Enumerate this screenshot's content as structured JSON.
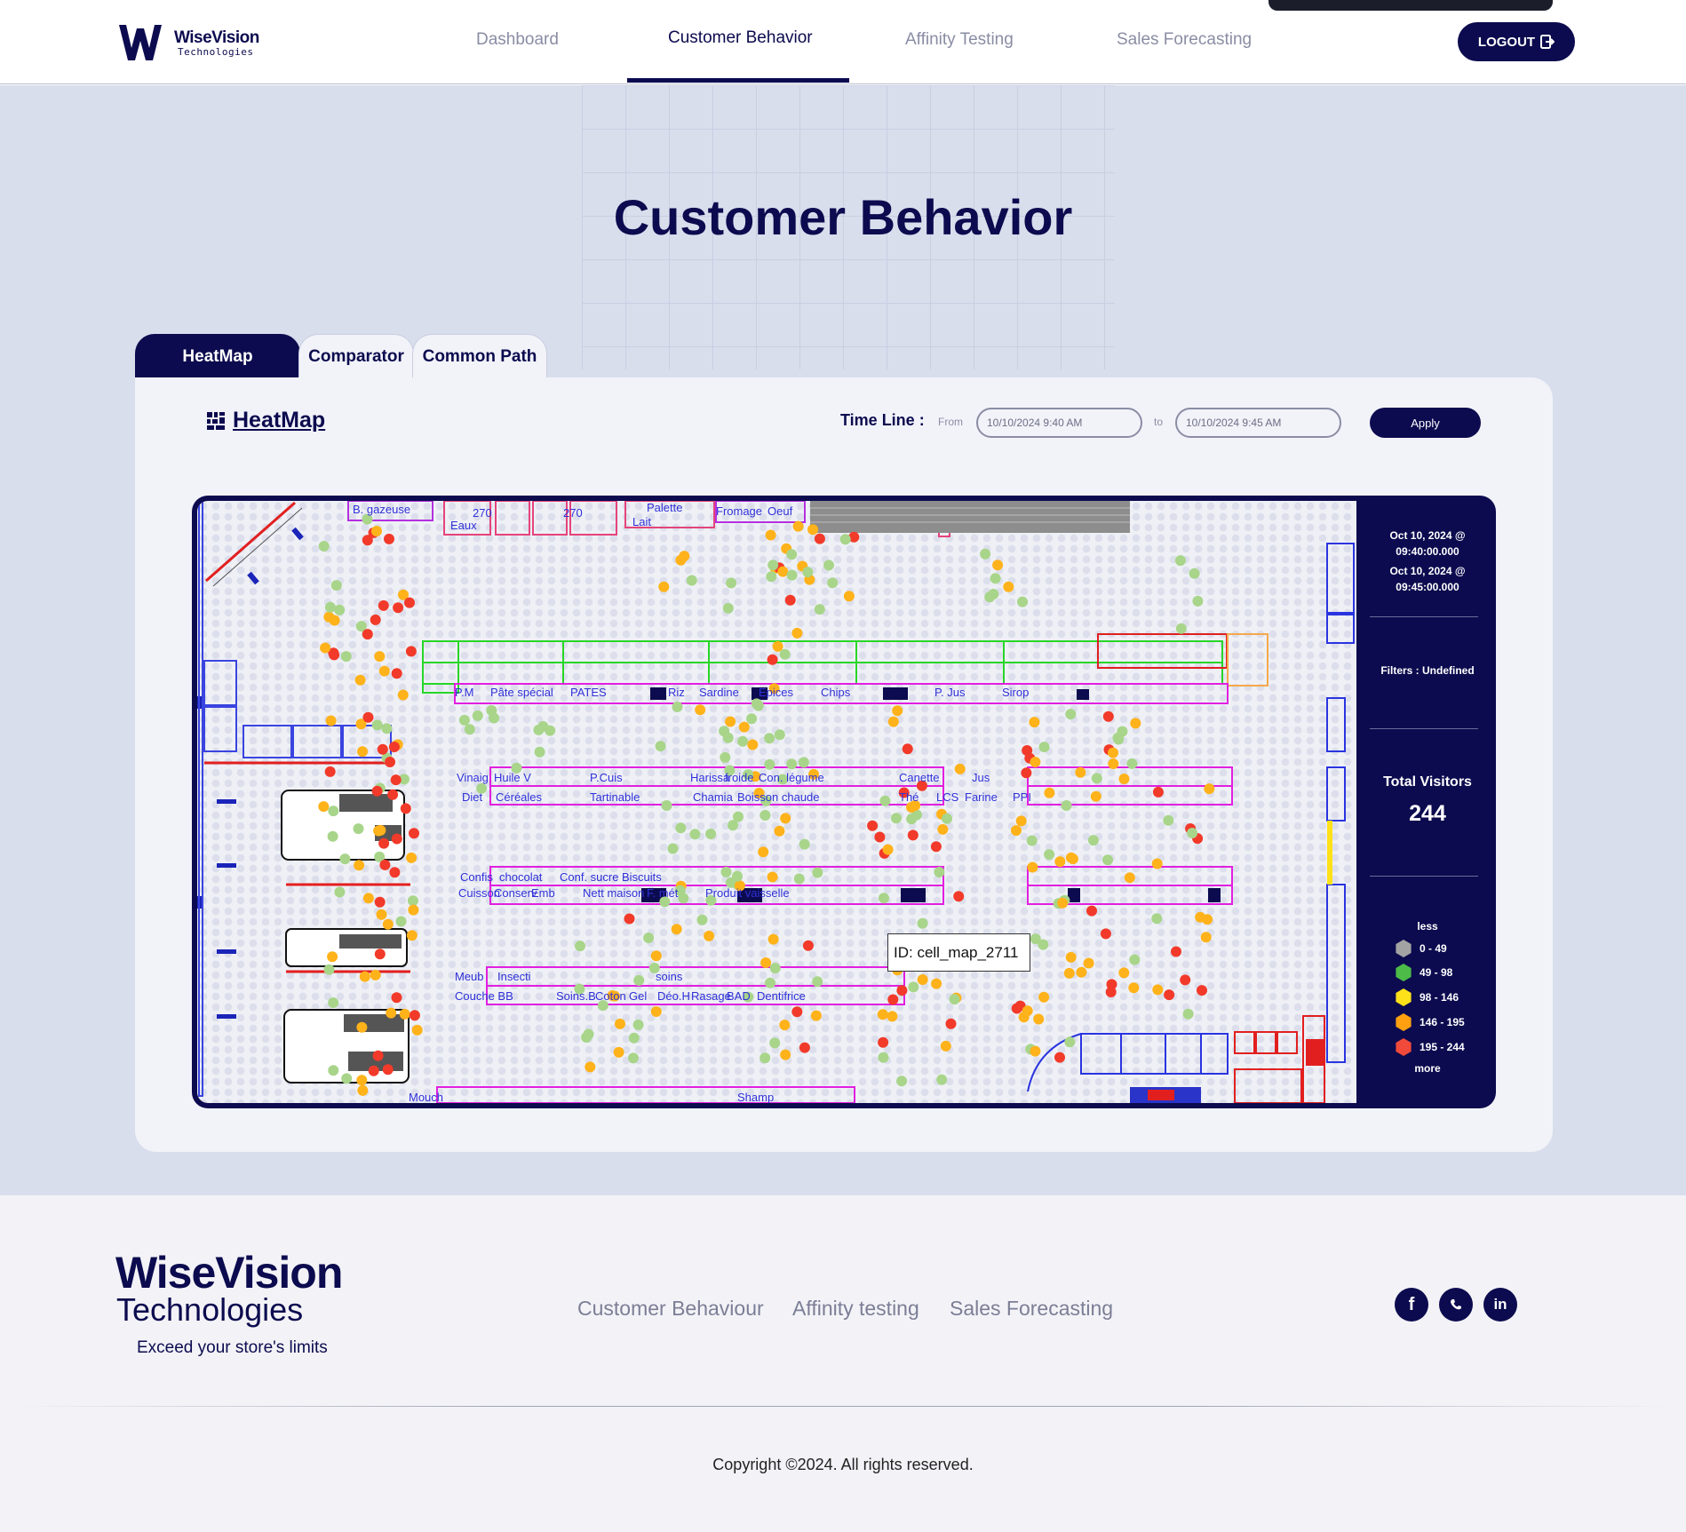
{
  "header": {
    "logo_name": "WiseVision",
    "logo_sub": "Technologies",
    "nav": [
      "Dashboard",
      "Customer Behavior",
      "Affinity Testing",
      "Sales Forecasting"
    ],
    "active_nav": "Customer Behavior",
    "logout_label": "LOGOUT"
  },
  "page": {
    "title": "Customer Behavior",
    "tabs": [
      "HeatMap",
      "Comparator",
      "Common Path"
    ],
    "active_tab": "HeatMap"
  },
  "heatmap": {
    "title": "HeatMap",
    "timeline_label": "Time Line :",
    "from_label": "From",
    "to_label": "to",
    "from_value": "10/10/2024 9:40 AM",
    "to_value": "10/10/2024 9:45 AM",
    "apply_label": "Apply",
    "tooltip": "ID: cell_map_2711",
    "map_labels": [
      "B. gazeuse",
      "Eaux",
      "270",
      "270",
      "Palette",
      "Lait",
      "Fromage",
      "Oeuf",
      "P.M",
      "Pâte spécial",
      "PATES",
      "Riz",
      "Sardine",
      "Epices",
      "Chips",
      "P. Jus",
      "Sirop",
      "Vinaig",
      "Huile V",
      "P.Cuis",
      "Harissa",
      "froide",
      "Con. légume",
      "Diet",
      "Céréales",
      "Tartinable",
      "Chamia",
      "Boisson chaude",
      "Canette",
      "Jus",
      "Thé",
      "LCS",
      "Farine",
      "PPI",
      "Confis",
      "chocolat",
      "Conf. sucre",
      "Biscuits",
      "Cuisson",
      "Conserv",
      "Emb",
      "Nett maison",
      "F. mét",
      "Produit vaisselle",
      "Meub",
      "Insecti",
      "soins",
      "Couche BB",
      "Soins.B",
      "Coton",
      "Gel",
      "Déo.H",
      "Rasage",
      "BAD",
      "Dentifrice",
      "Mouch",
      "Shamp"
    ],
    "side_panel": {
      "from_date": "Oct 10, 2024 @ 09:40:00.000",
      "to_date": "Oct 10, 2024 @ 09:45:00.000",
      "filters": "Filters : Undefined",
      "total_visitors_label": "Total Visitors",
      "total_visitors": "244",
      "legend_top": "less",
      "legend_bottom": "more",
      "legend": [
        {
          "range": "0 - 49",
          "color": "#a3a3a3"
        },
        {
          "range": "49 - 98",
          "color": "#4cbb47"
        },
        {
          "range": "98 - 146",
          "color": "#ffe11a"
        },
        {
          "range": "146 - 195",
          "color": "#ffa010"
        },
        {
          "range": "195 - 244",
          "color": "#f24a3a"
        }
      ]
    }
  },
  "footer": {
    "brand": "WiseVision",
    "brand_sub": "Technologies",
    "tagline": "Exceed your store's limits",
    "links": [
      "Customer Behaviour",
      "Affinity testing",
      "Sales Forecasting"
    ],
    "social": [
      "facebook-icon",
      "whatsapp-icon",
      "linkedin-icon"
    ],
    "copyright": "Copyright ©2024. All rights reserved."
  },
  "colors": {
    "primary": "#0c0b4f",
    "hero_bg": "#d9deed",
    "heat_low": "#a8d58a",
    "heat_mid": "#ffb21a",
    "heat_high": "#f23a2a"
  }
}
